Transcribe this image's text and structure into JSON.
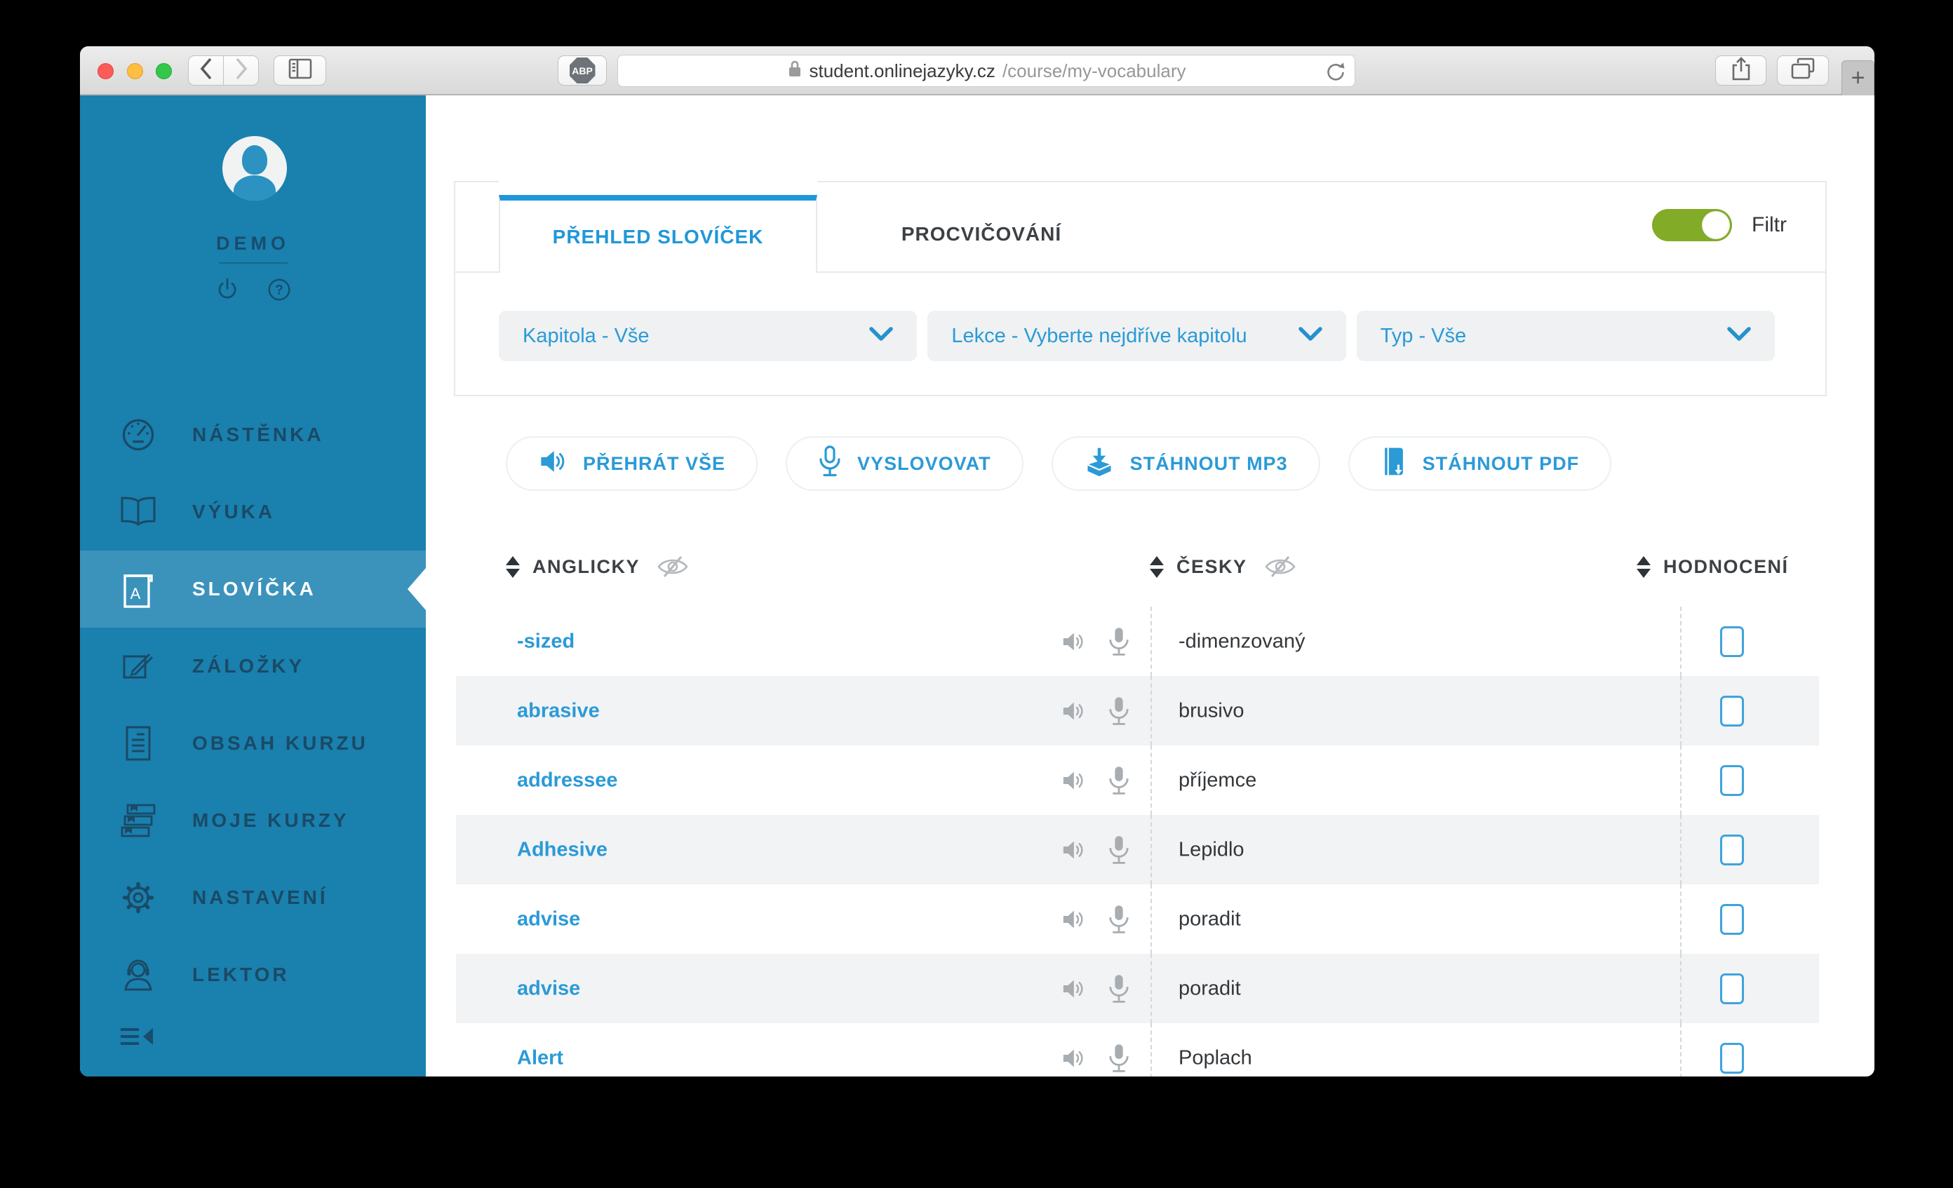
{
  "colors": {
    "accent": "#2b9ad7",
    "tab-blue": "#1f97d9",
    "sidebar-bg": "#1a80ae",
    "sidebar-active-bg": "#3b93bc",
    "toggle-green": "#82ab27",
    "row-stripe": "#f2f3f4",
    "border": "#e7e9ea",
    "dashed": "#d4d8db",
    "checkbox-border": "#3fa3dd"
  },
  "browser": {
    "url_domain": "student.onlinejazyky.cz",
    "url_path": "/course/my-vocabulary",
    "adblock_label": "ABP",
    "new_tab_label": "+"
  },
  "sidebar": {
    "username": "DEMO",
    "items": [
      {
        "label": "NÁSTĚNKA"
      },
      {
        "label": "VÝUKA"
      },
      {
        "label": "SLOVÍČKA"
      },
      {
        "label": "ZÁLOŽKY"
      },
      {
        "label": "OBSAH KURZU"
      },
      {
        "label": "MOJE KURZY"
      },
      {
        "label": "NASTAVENÍ"
      },
      {
        "label": "LEKTOR"
      }
    ]
  },
  "main": {
    "tabs": {
      "overview": "PŘEHLED SLOVÍČEK",
      "practice": "PROCVIČOVÁNÍ"
    },
    "filter_toggle_label": "Filtr",
    "dropdowns": {
      "chapter": "Kapitola - Vše",
      "lesson": "Lekce - Vyberte nejdříve kapitolu",
      "type": "Typ - Vše"
    },
    "actions": [
      {
        "label": "PŘEHRÁT VŠE"
      },
      {
        "label": "VYSLOVOVAT"
      },
      {
        "label": "STÁHNOUT MP3"
      },
      {
        "label": "STÁHNOUT PDF"
      }
    ],
    "table": {
      "columns": [
        "ANGLICKY",
        "ČESKY",
        "HODNOCENÍ"
      ],
      "rows": [
        {
          "en": "-sized",
          "cs": "-dimenzovaný",
          "checked": false
        },
        {
          "en": "abrasive",
          "cs": "brusivo",
          "checked": false
        },
        {
          "en": "addressee",
          "cs": "příjemce",
          "checked": false
        },
        {
          "en": "Adhesive",
          "cs": "Lepidlo",
          "checked": false
        },
        {
          "en": "advise",
          "cs": "poradit",
          "checked": false
        },
        {
          "en": "advise",
          "cs": "poradit",
          "checked": false
        },
        {
          "en": "Alert",
          "cs": "Poplach",
          "checked": false
        }
      ]
    }
  }
}
